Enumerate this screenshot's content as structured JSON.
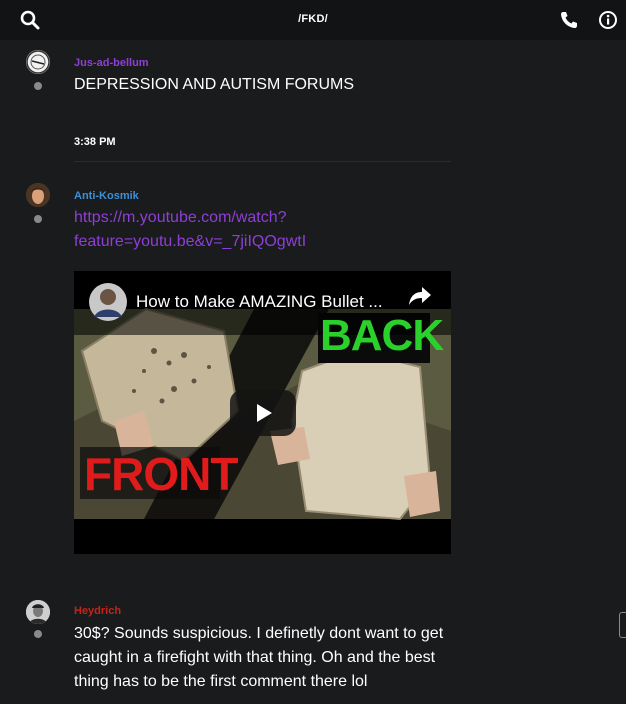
{
  "header": {
    "title": "/FKD/",
    "icons": [
      "search-icon",
      "phone-icon",
      "info-icon"
    ]
  },
  "messages": [
    {
      "username": "Jus-ad-bellum",
      "username_color": "#8e3fd6",
      "text": "DEPRESSION AND AUTISM FORUMS"
    },
    {
      "username": "Anti-Kosmik",
      "username_color": "#3d8fd6",
      "link_line1": "https://m.youtube.com/watch?",
      "link_line2": "feature=youtu.be&v=_7jiIQOgwtI",
      "video": {
        "title": "How to Make AMAZING Bullet ...",
        "label_back": "BACK",
        "label_front": "FRONT"
      }
    },
    {
      "username": "Heydrich",
      "username_color": "#c0261d",
      "lines": [
        "30$? Sounds suspicious. I definetly dont want to get",
        "caught in a firefight with that thing. Oh and the best",
        "thing has to be the first comment there lol"
      ]
    }
  ],
  "timestamp": "3:38 PM",
  "colors": {
    "background": "#1a1b1d",
    "topbar": "#121315",
    "link": "#8e3fd6"
  }
}
